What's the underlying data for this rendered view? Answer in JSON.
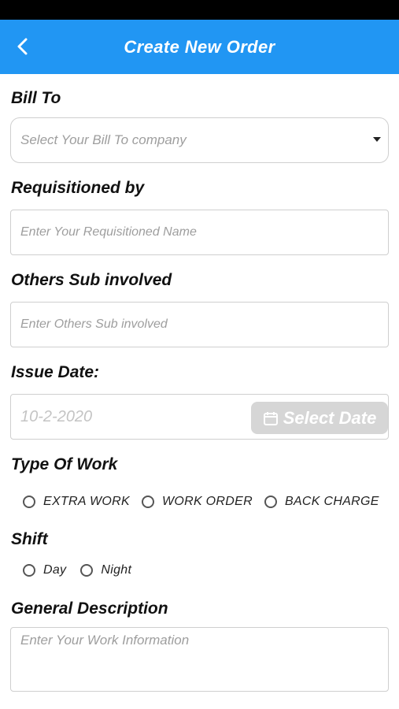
{
  "header": {
    "title": "Create New Order"
  },
  "form": {
    "bill_to": {
      "label": "Bill To",
      "placeholder": "Select Your Bill To company"
    },
    "requisitioned_by": {
      "label": "Requisitioned by",
      "placeholder": "Enter Your Requisitioned Name"
    },
    "others_sub": {
      "label": "Others Sub involved",
      "placeholder": "Enter Others Sub involved"
    },
    "issue_date": {
      "label": "Issue Date:",
      "value": "10-2-2020",
      "button_label": "Select Date"
    },
    "type_of_work": {
      "label": "Type Of Work",
      "options": [
        "EXTRA WORK",
        "WORK ORDER",
        "BACK CHARGE"
      ]
    },
    "shift": {
      "label": "Shift",
      "options": [
        "Day",
        "Night"
      ]
    },
    "general_description": {
      "label": "General Description",
      "placeholder": "Enter Your Work Information"
    }
  },
  "colors": {
    "app_bar": "#2196f3",
    "date_button": "#d6d6d6"
  }
}
